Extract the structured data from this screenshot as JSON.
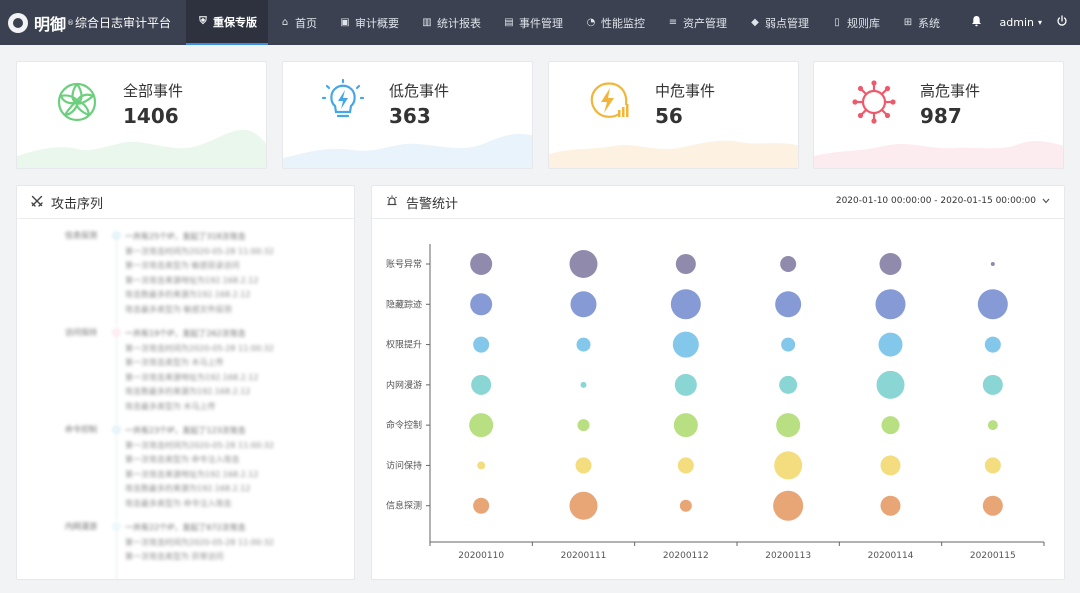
{
  "header": {
    "brand": "明御",
    "brand_reg": "®",
    "brand_sub": "综合日志审计平台",
    "nav": [
      {
        "label": "重保专版",
        "icon": "shield-icon",
        "glyph": "⛨",
        "active": true
      },
      {
        "label": "首页",
        "icon": "home-icon",
        "glyph": "⌂",
        "active": false
      },
      {
        "label": "审计概要",
        "icon": "monitor-icon",
        "glyph": "▣",
        "active": false
      },
      {
        "label": "统计报表",
        "icon": "bar-chart-icon",
        "glyph": "▥",
        "active": false
      },
      {
        "label": "事件管理",
        "icon": "event-icon",
        "glyph": "▤",
        "active": false
      },
      {
        "label": "性能监控",
        "icon": "gauge-icon",
        "glyph": "◔",
        "active": false
      },
      {
        "label": "资产管理",
        "icon": "database-icon",
        "glyph": "≡",
        "active": false
      },
      {
        "label": "弱点管理",
        "icon": "bug-icon",
        "glyph": "◆",
        "active": false
      },
      {
        "label": "规则库",
        "icon": "book-icon",
        "glyph": "▯",
        "active": false
      },
      {
        "label": "系统",
        "icon": "grid-icon",
        "glyph": "⊞",
        "active": false
      }
    ],
    "user": "admin",
    "bell_icon": "bell-icon",
    "power_icon": "power-icon"
  },
  "cards": [
    {
      "label": "全部事件",
      "value": "1406",
      "icon": "all-events-icon",
      "color": "#6ccf7e"
    },
    {
      "label": "低危事件",
      "value": "363",
      "icon": "bulb-icon",
      "color": "#45a7e6"
    },
    {
      "label": "中危事件",
      "value": "56",
      "icon": "bolt-chart-icon",
      "color": "#f2b53a"
    },
    {
      "label": "高危事件",
      "value": "987",
      "icon": "virus-icon",
      "color": "#ee5a6b"
    }
  ],
  "attack_panel": {
    "title": "攻击序列",
    "groups": [
      {
        "stage": "信息探测",
        "color": "#8fd3e8",
        "lines": [
          "一共有25个IP，发起了318次攻击",
          "第一次攻击时间为2020-05-28 11:00:32",
          "第一次攻击类型为 敏感目录访问",
          "第一次攻击来源地址为192.168.2.12",
          "攻击数最多的来源为192.168.2.12",
          "攻击最多类型为 敏感文件探测"
        ]
      },
      {
        "stage": "访问保持",
        "color": "#f4b4c4",
        "lines": [
          "一共有19个IP，发起了262次攻击",
          "第一次攻击时间为2020-05-28 11:00:32",
          "第一次攻击类型为 木马上传",
          "第一次攻击来源地址为192.168.2.12",
          "攻击数最多的来源为192.168.2.12",
          "攻击最多类型为 木马上传"
        ]
      },
      {
        "stage": "命令控制",
        "color": "#8fd3e8",
        "lines": [
          "一共有23个IP，发起了123次攻击",
          "第一次攻击时间为2020-05-28 11:00:32",
          "第一次攻击类型为 命令注入攻击",
          "第一次攻击来源地址为192.168.2.12",
          "攻击数最多的来源为192.168.2.12",
          "攻击最多类型为 命令注入攻击"
        ]
      },
      {
        "stage": "内网漫游",
        "color": "#b9e3f3",
        "lines": [
          "一共有22个IP，发起了672次攻击",
          "第一次攻击时间为2020-05-28 11:00:32",
          "第一次攻击类型为 异常访问"
        ]
      }
    ]
  },
  "alarm_panel": {
    "title": "告警统计",
    "date_range": "2020-01-10 00:00:00 - 2020-01-15 00:00:00"
  },
  "chart_data": {
    "type": "scatter",
    "subtype": "bubble",
    "title": "",
    "xlabel": "",
    "ylabel": "",
    "x": [
      "20200110",
      "20200111",
      "20200112",
      "20200113",
      "20200114",
      "20200115"
    ],
    "categories": [
      "账号异常",
      "隐藏踪迹",
      "权限提升",
      "内网漫游",
      "命令控制",
      "访问保持",
      "信息探测"
    ],
    "series": [
      {
        "category": "账号异常",
        "color": "#8a85a8",
        "sizes": [
          11,
          14,
          10,
          8,
          11,
          2
        ]
      },
      {
        "category": "隐藏踪迹",
        "color": "#7f95d4",
        "sizes": [
          11,
          13,
          15,
          13,
          15,
          15
        ]
      },
      {
        "category": "权限提升",
        "color": "#7cc4ea",
        "sizes": [
          8,
          7,
          13,
          7,
          12,
          8
        ]
      },
      {
        "category": "内网漫游",
        "color": "#84d4d2",
        "sizes": [
          10,
          3,
          11,
          9,
          14,
          10
        ]
      },
      {
        "category": "命令控制",
        "color": "#b5dd7c",
        "sizes": [
          12,
          6,
          12,
          12,
          9,
          5
        ]
      },
      {
        "category": "访问保持",
        "color": "#f2db77",
        "sizes": [
          4,
          8,
          8,
          14,
          10,
          8
        ]
      },
      {
        "category": "信息探测",
        "color": "#e7a06f",
        "sizes": [
          8,
          14,
          6,
          15,
          10,
          10
        ]
      }
    ],
    "grid": false,
    "legend": "none"
  }
}
